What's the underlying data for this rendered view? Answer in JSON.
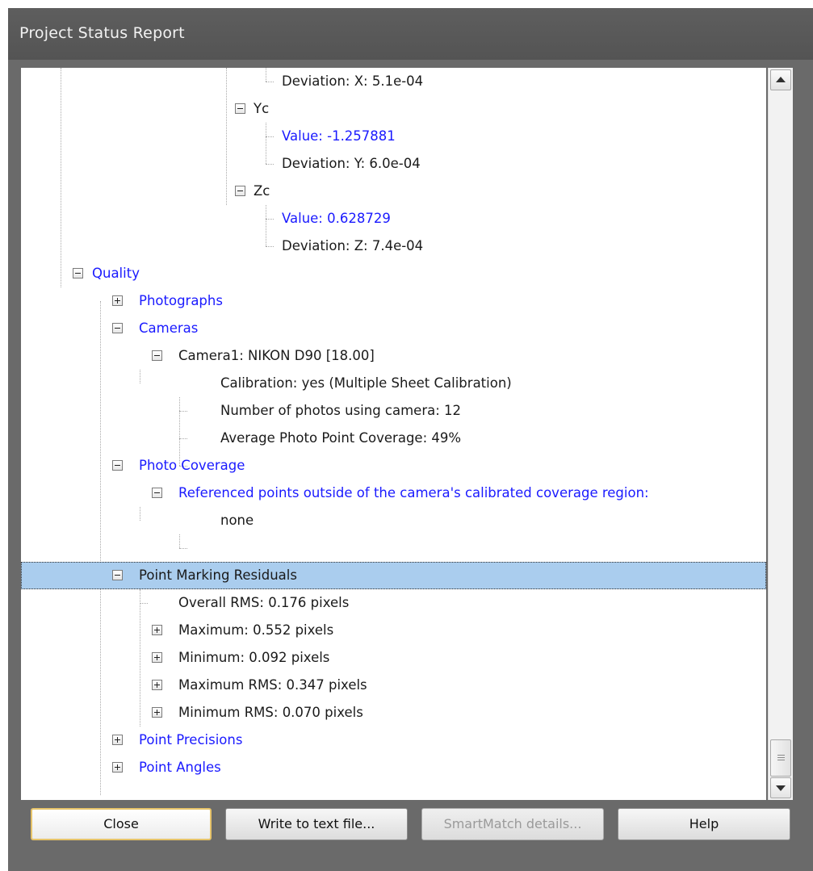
{
  "window": {
    "title": "Project Status Report"
  },
  "tree": {
    "rows": [
      {
        "label": "Deviation: X: 5.1e-04",
        "toggle": "",
        "color": "black"
      },
      {
        "label": "Yc",
        "toggle": "-",
        "color": "black"
      },
      {
        "label": "Value: -1.257881",
        "toggle": "",
        "color": "blue"
      },
      {
        "label": "Deviation: Y: 6.0e-04",
        "toggle": "",
        "color": "black"
      },
      {
        "label": "Zc",
        "toggle": "-",
        "color": "black"
      },
      {
        "label": "Value: 0.628729",
        "toggle": "",
        "color": "blue"
      },
      {
        "label": "Deviation: Z: 7.4e-04",
        "toggle": "",
        "color": "black"
      },
      {
        "label": "Quality",
        "toggle": "-",
        "color": "blue"
      },
      {
        "label": "Photographs",
        "toggle": "+",
        "color": "blue"
      },
      {
        "label": "Cameras",
        "toggle": "-",
        "color": "blue"
      },
      {
        "label": "Camera1: NIKON D90 [18.00]",
        "toggle": "-",
        "color": "black"
      },
      {
        "label": "Calibration: yes (Multiple Sheet Calibration)",
        "toggle": "",
        "color": "black"
      },
      {
        "label": "Number of photos using camera: 12",
        "toggle": "",
        "color": "black"
      },
      {
        "label": "Average Photo Point Coverage: 49%",
        "toggle": "",
        "color": "black"
      },
      {
        "label": "Photo Coverage",
        "toggle": "-",
        "color": "blue"
      },
      {
        "label": "Referenced points outside of the camera's calibrated coverage region:",
        "toggle": "-",
        "color": "blue"
      },
      {
        "label": "none",
        "toggle": "",
        "color": "black"
      },
      {
        "label": "Point Marking Residuals",
        "toggle": "-",
        "color": "black",
        "selected": true
      },
      {
        "label": "Overall RMS: 0.176 pixels",
        "toggle": "",
        "color": "black"
      },
      {
        "label": "Maximum: 0.552 pixels",
        "toggle": "+",
        "color": "black"
      },
      {
        "label": "Minimum: 0.092 pixels",
        "toggle": "+",
        "color": "black"
      },
      {
        "label": "Maximum RMS: 0.347 pixels",
        "toggle": "+",
        "color": "black"
      },
      {
        "label": "Minimum RMS: 0.070 pixels",
        "toggle": "+",
        "color": "black"
      },
      {
        "label": "Point Precisions",
        "toggle": "+",
        "color": "blue"
      },
      {
        "label": "Point Angles",
        "toggle": "+",
        "color": "blue"
      }
    ]
  },
  "scrollbar": {
    "up_icon": "triangle-up",
    "down_icon": "triangle-down",
    "grip_icon": "grip-lines"
  },
  "buttons": {
    "close": "Close",
    "write": "Write to text file...",
    "smartmatch": "SmartMatch details...",
    "help": "Help"
  },
  "colors": {
    "link_blue": "#1a1aff",
    "selection": "#aacdee",
    "default_button_border": "#e6c36a"
  }
}
